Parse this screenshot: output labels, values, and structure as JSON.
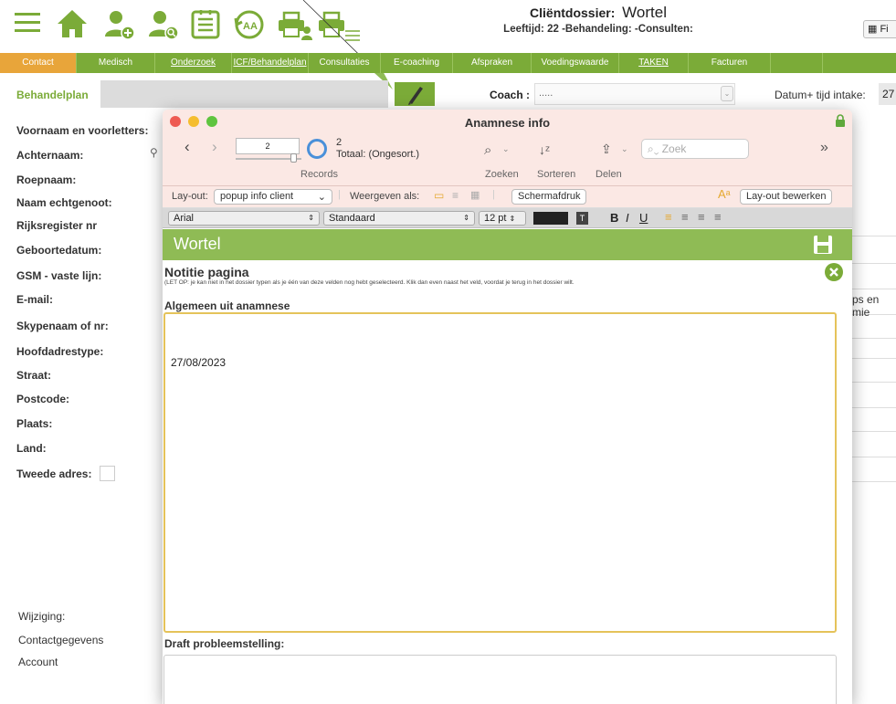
{
  "header": {
    "title_prefix": "Cliëntdossier:",
    "client_name": "Wortel",
    "subtitle": "Leeftijd: 22 -Behandeling: -Consulten:",
    "fiche_label": "Fi"
  },
  "nav": [
    {
      "label": "Contact",
      "active": true,
      "underline": false
    },
    {
      "label": "Medisch",
      "active": false,
      "underline": false
    },
    {
      "label": "Onderzoek",
      "active": false,
      "underline": true
    },
    {
      "label": "ICF/Behandelplan",
      "active": false,
      "underline": true
    },
    {
      "label": "Consultaties",
      "active": false,
      "underline": false
    },
    {
      "label": "E-coaching",
      "active": false,
      "underline": false
    },
    {
      "label": "Afspraken",
      "active": false,
      "underline": false
    },
    {
      "label": "Voedingswaarde",
      "active": false,
      "underline": false
    },
    {
      "label": "TAKEN",
      "active": false,
      "underline": true
    },
    {
      "label": "Facturen",
      "active": false,
      "underline": false
    }
  ],
  "behandelplan": {
    "label": "Behandelplan",
    "coach_label": "Coach :",
    "coach_value": ".....",
    "intake_label": "Datum+ tijd intake:",
    "intake_value": "27"
  },
  "form_labels": [
    "Voornaam en voorletters:",
    "Achternaam:",
    "Roepnaam:",
    "Naam echtgenoot:",
    "Rijksregister nr",
    "Geboortedatum:",
    "GSM -  vaste lijn:",
    "E-mail:",
    "Skypenaam of nr:",
    "Hoofdadrestype:",
    "Straat:",
    "Postcode:",
    "Plaats:",
    "Land:",
    "Tweede adres:"
  ],
  "bottom_labels": [
    "Wijziging:",
    "Contactgegevens",
    "Account"
  ],
  "right_fragment": "ps en mie",
  "popup": {
    "title": "Anamnese info",
    "record_current": "2",
    "record_total": "2",
    "total_label": "Totaal: (Ongesort.)",
    "records_label": "Records",
    "zoeken_label": "Zoeken",
    "sorteren_label": "Sorteren",
    "delen_label": "Delen",
    "search_placeholder": "Zoek",
    "layout_label": "Lay-out:",
    "layout_value": "popup info client",
    "weergeven_label": "Weergeven als:",
    "schermafdruk_label": "Schermafdruk",
    "edit_layout_label": "Lay-out bewerken",
    "font_value": "Arial",
    "style_value": "Standaard",
    "size_value": "12 pt",
    "bold_label": "B",
    "italic_label": "I",
    "underline_label": "U",
    "record_title": "Wortel",
    "notitie_title": "Notitie pagina",
    "notitie_note": "(LET OP: je kan niet in het dossier typen als je één van deze velden nog hebt geselecteerd. Klik dan even naast het veld, voordat je terug in het dossier wilt.",
    "algemeen_label": "Algemeen uit anamnese",
    "algemeen_text": "27/08/2023",
    "draft_label": "Draft probleemstelling:"
  },
  "colors": {
    "brand_green": "#7bab38",
    "active_orange": "#e8a53a",
    "popup_pink": "#fbe8e4",
    "field_highlight": "#e5c35a"
  },
  "icons": [
    "menu-icon",
    "home-icon",
    "add-client-icon",
    "search-client-icon",
    "checklist-icon",
    "history-icon",
    "print-client-icon",
    "print-list-icon",
    "pen-icon",
    "lock-icon",
    "save-icon",
    "close-icon"
  ]
}
